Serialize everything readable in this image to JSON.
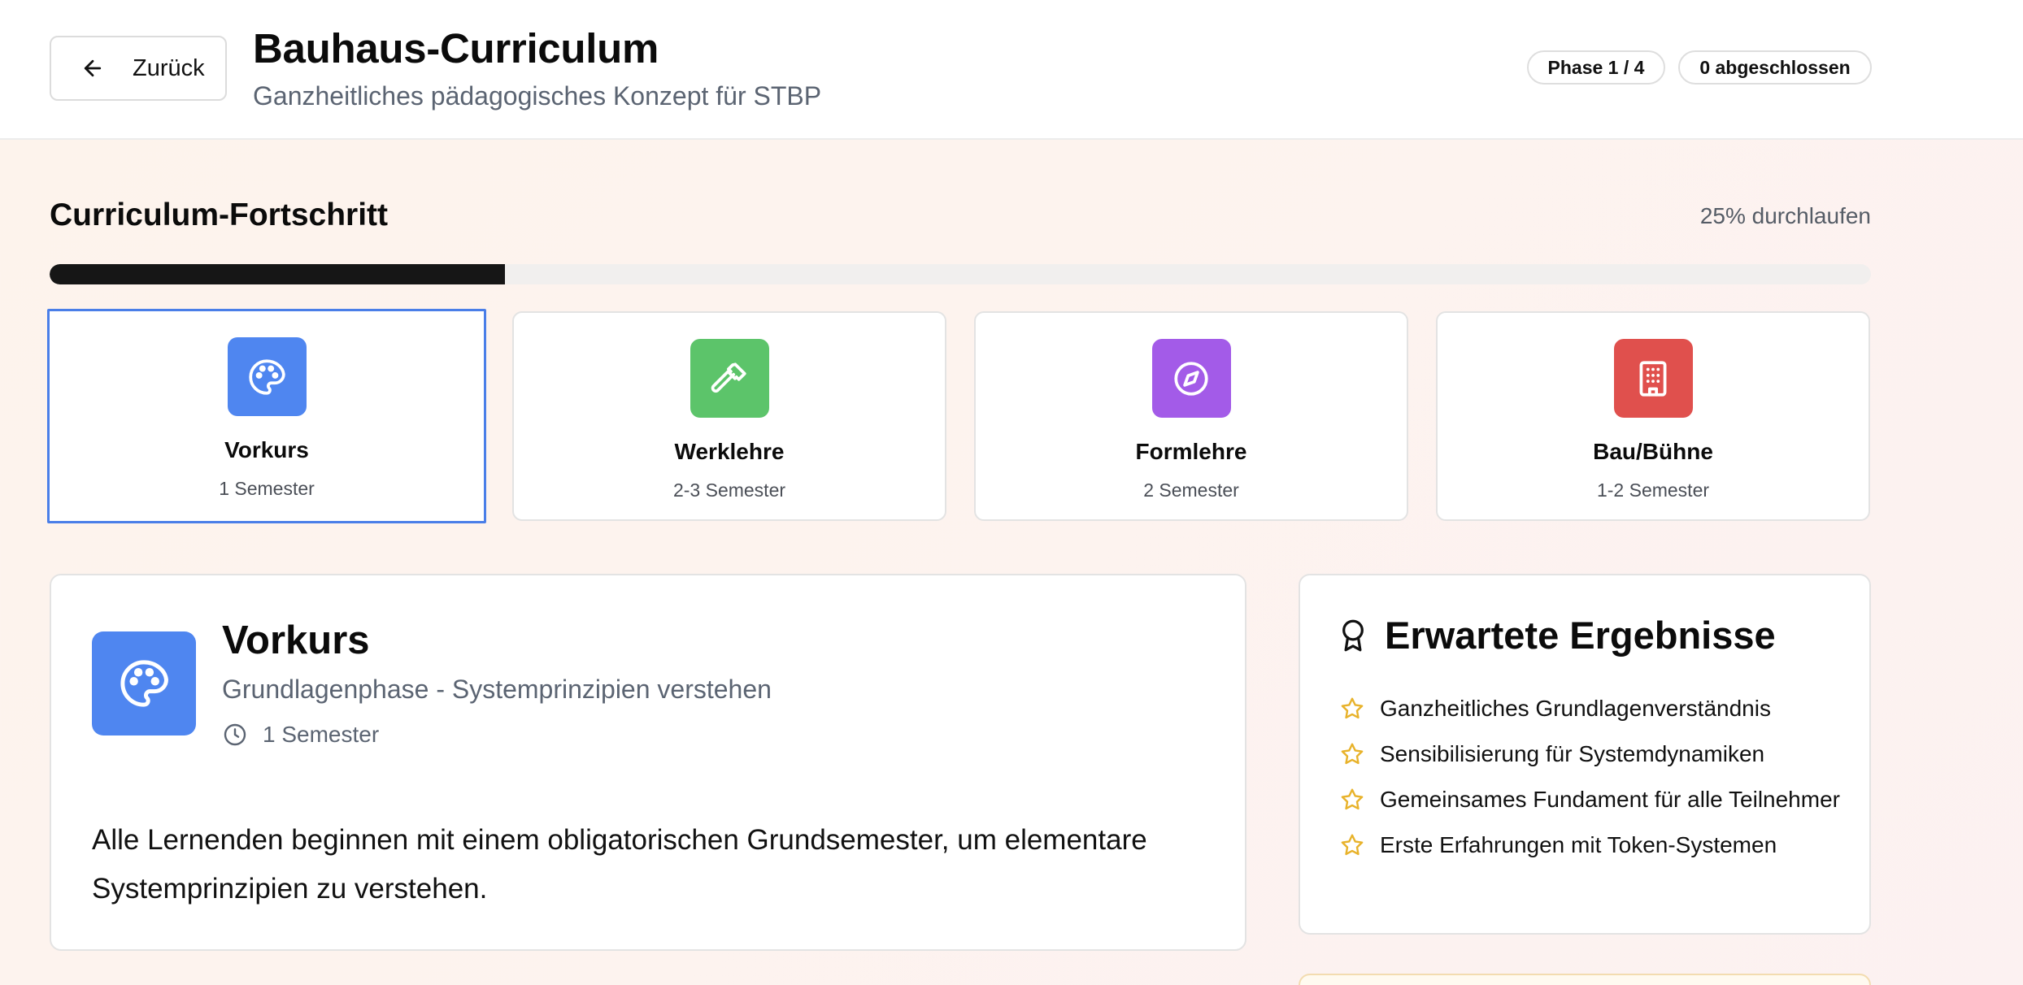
{
  "header": {
    "back_label": "Zurück",
    "title": "Bauhaus-Curriculum",
    "subtitle": "Ganzheitliches pädagogisches Konzept für STBP",
    "phase_badge": "Phase 1 / 4",
    "completed_badge": "0 abgeschlossen"
  },
  "progress": {
    "title": "Curriculum-Fortschritt",
    "percent_label": "25% durchlaufen",
    "value": 0.25
  },
  "phases": [
    {
      "name": "Vorkurs",
      "duration": "1 Semester",
      "icon": "palette-icon",
      "color": "#4f86f0",
      "selected": true
    },
    {
      "name": "Werklehre",
      "duration": "2-3 Semester",
      "icon": "hammer-icon",
      "color": "#5cc46a",
      "selected": false
    },
    {
      "name": "Formlehre",
      "duration": "2 Semester",
      "icon": "compass-icon",
      "color": "#a35be8",
      "selected": false
    },
    {
      "name": "Bau/Bühne",
      "duration": "1-2 Semester",
      "icon": "building-icon",
      "color": "#e0504d",
      "selected": false
    }
  ],
  "detail": {
    "title": "Vorkurs",
    "subtitle": "Grundlagenphase - Systemprinzipien verstehen",
    "duration": "1 Semester",
    "description": "Alle Lernenden beginnen mit einem obligatorischen Grundsemester, um elementare Systemprinzipien zu verstehen."
  },
  "results": {
    "title": "Erwartete Ergebnisse",
    "items": [
      "Ganzheitliches Grundlagenverständnis",
      "Sensibilisierung für Systemdynamiken",
      "Gemeinsames Fundament für alle Teilnehmer",
      "Erste Erfahrungen mit Token-Systemen"
    ],
    "star_color": "#e8b22a"
  }
}
